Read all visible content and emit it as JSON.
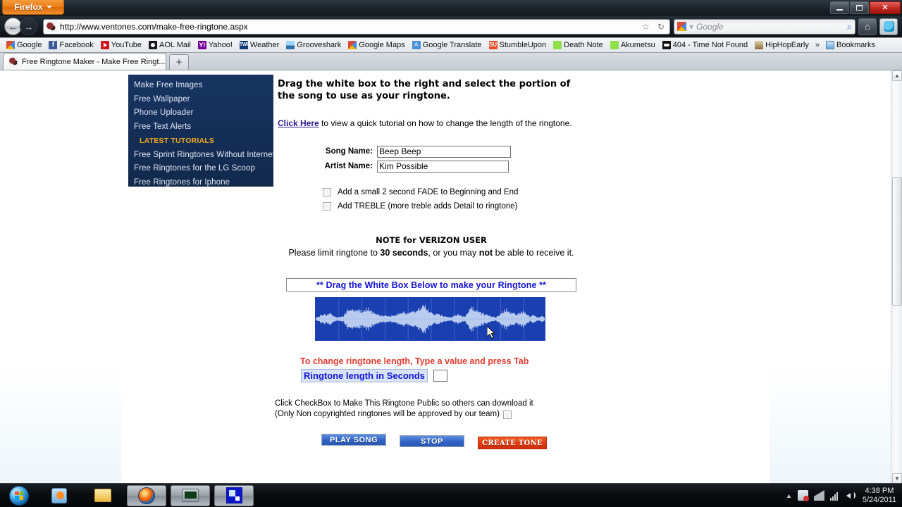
{
  "browser": {
    "app_button": "Firefox",
    "url": "http://www.ventones.com/make-free-ringtone.aspx",
    "search_placeholder": "Google",
    "tab_title": "Free Ringtone Maker - Make Free Ringt...",
    "new_tab_label": "+",
    "back_glyph": "←",
    "forward_glyph": "→",
    "reload_glyph": "↻",
    "star_glyph": "☆",
    "dropdown_glyph": "▾",
    "home_glyph": "⌂",
    "search_glyph": "⌕",
    "minimize_label": "Minimize",
    "maximize_label": "Maximize",
    "close_label": "✕",
    "bookmarks_overflow": "»",
    "bookmarks": [
      {
        "label": "Google",
        "icon": "google-icon"
      },
      {
        "label": "Facebook",
        "icon": "facebook-icon"
      },
      {
        "label": "YouTube",
        "icon": "youtube-icon"
      },
      {
        "label": "AOL Mail",
        "icon": "aol-icon"
      },
      {
        "label": "Yahoo!",
        "icon": "yahoo-icon"
      },
      {
        "label": "Weather",
        "icon": "weather-icon"
      },
      {
        "label": "Grooveshark",
        "icon": "grooveshark-icon"
      },
      {
        "label": "Google Maps",
        "icon": "google-maps-icon"
      },
      {
        "label": "Google Translate",
        "icon": "google-translate-icon"
      },
      {
        "label": "StumbleUpon",
        "icon": "stumbleupon-icon"
      },
      {
        "label": "Death Note",
        "icon": "green-bookmark-icon"
      },
      {
        "label": "Akumetsu",
        "icon": "green-bookmark-icon"
      },
      {
        "label": "404 - Time Not Found",
        "icon": "dark-bookmark-icon"
      },
      {
        "label": "HipHopEarly",
        "icon": "hiphopearly-icon"
      }
    ],
    "bookmarks_folder": "Bookmarks"
  },
  "sidebar": {
    "items": [
      {
        "label": "Make Free Images"
      },
      {
        "label": "Free Wallpaper"
      },
      {
        "label": "Phone Uploader"
      },
      {
        "label": "Free Text Alerts"
      }
    ],
    "heading": "LATEST TUTORIALS",
    "tutorials": [
      {
        "label": "Free Sprint Ringtones Without Internet"
      },
      {
        "label": "Free Ringtones for the LG Scoop"
      },
      {
        "label": "Free Ringtones for Iphone"
      }
    ]
  },
  "main": {
    "lead": "Drag the white box to the right and select the portion of the song to use as your ringtone.",
    "tutorial_link": "Click Here",
    "tutorial_rest": " to view a quick tutorial on how to change the length of the ringtone.",
    "song_label": "Song Name:",
    "song_value": "Beep Beep",
    "artist_label": "Artist Name:",
    "artist_value": "Kim Possible",
    "option_fade": "Add a small 2 second FADE to Beginning and End",
    "option_treble": "Add TREBLE (more treble adds Detail to ringtone)",
    "note_title": "NOTE for VERIZON USER",
    "note_pre": "Please limit ringtone to ",
    "note_bold_seconds": "30 seconds",
    "note_mid": ", or you may ",
    "note_bold_not": "not",
    "note_post": " be able to receive it.",
    "drag_header": "** Drag the White Box Below to make your Ringtone **",
    "length_note": "To change ringtone length, Type a value and press Tab",
    "length_label": "Ringtone length in Seconds",
    "length_value": "",
    "public_line1": "Click CheckBox to Make This Ringtone Public so others can download it",
    "public_line2": "(Only Non copyrighted ringtones will be approved by our team)",
    "play_button": "PLAY SONG",
    "stop_button": "STOP",
    "create_button": "CREATE TONE",
    "colors": {
      "sidebar_bg": "#15305c",
      "sidebar_heading": "#f0a81e",
      "link_blue": "#2a1a8f",
      "heading_blue": "#1414d2",
      "warning_red": "#e03b2f",
      "waveform_bg": "#1a3fb0",
      "waveform_fg": "#b9ccf0",
      "play_button_bg": "#2f62c4",
      "create_button_bg": "#e03a10"
    }
  },
  "taskbar": {
    "start_label": "Start",
    "items": [
      {
        "name": "windows-media-player",
        "label": "Windows Media Player"
      },
      {
        "name": "windows-explorer",
        "label": "Windows Explorer"
      },
      {
        "name": "firefox",
        "label": "Mozilla Firefox"
      },
      {
        "name": "remote-desktop",
        "label": "Remote Desktop"
      },
      {
        "name": "blue-app",
        "label": "Application"
      }
    ],
    "time": "4:38 PM",
    "date": "5/24/2011",
    "tray_caret": "▲"
  }
}
